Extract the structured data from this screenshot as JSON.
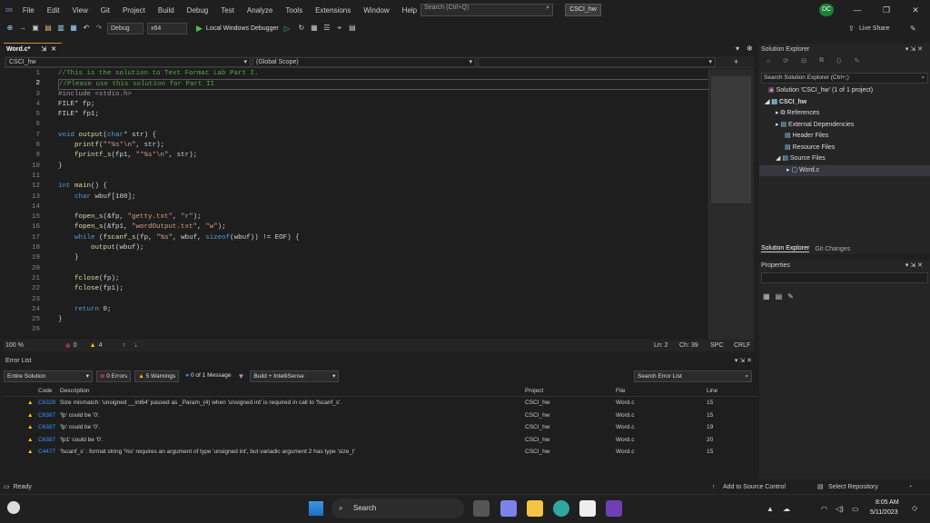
{
  "menu": {
    "items": [
      "File",
      "Edit",
      "View",
      "Git",
      "Project",
      "Build",
      "Debug",
      "Test",
      "Analyze",
      "Tools",
      "Extensions",
      "Window",
      "Help"
    ],
    "search_placeholder": "Search (Ctrl+Q)",
    "solution_badge": "CSCI_hw",
    "avatar_initials": "DC",
    "live_share": "Live Share"
  },
  "toolbar": {
    "config": "Debug",
    "platform": "x64",
    "run_label": "Local Windows Debugger"
  },
  "editor": {
    "tab_label": "Word.c*",
    "nav_project": "CSCI_hw",
    "nav_scope": "(Global Scope)",
    "line_numbers": [
      "1",
      "2",
      "3",
      "4",
      "5",
      "6",
      "7",
      "8",
      "9",
      "10",
      "11",
      "12",
      "13",
      "14",
      "15",
      "16",
      "17",
      "18",
      "19",
      "20",
      "21",
      "22",
      "23",
      "24",
      "25",
      "26"
    ],
    "zoom": "100 %",
    "errors_count": "0",
    "warnings_count": "4",
    "position_line": "Ln: 2",
    "position_col": "Ch: 39",
    "spacing": "SPC",
    "line_ending": "CRLF"
  },
  "solution_explorer": {
    "title": "Solution Explorer",
    "search_placeholder": "Search Solution Explorer (Ctrl+;)",
    "solution_node": "Solution 'CSCI_hw' (1 of 1 project)",
    "project_node": "CSCI_hw",
    "children": [
      "References",
      "External Dependencies",
      "Header Files",
      "Resource Files",
      "Source Files"
    ],
    "file_node": "Word.c",
    "bottom_tabs": [
      "Solution Explorer",
      "Git Changes"
    ]
  },
  "properties": {
    "title": "Properties"
  },
  "error_list": {
    "title": "Error List",
    "scope": "Entire Solution",
    "errors_btn": "0 Errors",
    "warnings_btn": "5 Warnings",
    "messages_btn": "0 of 1 Message",
    "build_filter": "Build + IntelliSense",
    "search_placeholder": "Search Error List",
    "columns": [
      "Code",
      "Description",
      "Project",
      "File",
      "Line"
    ],
    "rows": [
      {
        "code": "C6328",
        "desc": "Size mismatch: 'unsigned __int64' passed as _Param_(4) when 'unsigned int' is required in call to 'fscanf_s'.",
        "project": "CSCI_hw",
        "file": "Word.c",
        "line": "15"
      },
      {
        "code": "C6387",
        "desc": "'fp' could be '0'.",
        "project": "CSCI_hw",
        "file": "Word.c",
        "line": "15"
      },
      {
        "code": "C6387",
        "desc": "'fp' could be '0'.",
        "project": "CSCI_hw",
        "file": "Word.c",
        "line": "19"
      },
      {
        "code": "C6387",
        "desc": "'fp1' could be '0'.",
        "project": "CSCI_hw",
        "file": "Word.c",
        "line": "20"
      },
      {
        "code": "C4477",
        "desc": "'fscanf_s' : format string '%s' requires an argument of type 'unsigned int', but variadic argument 2 has type 'size_t'",
        "project": "CSCI_hw",
        "file": "Word.c",
        "line": "15"
      }
    ]
  },
  "status": {
    "ready": "Ready",
    "add_source": "Add to Source Control",
    "select_repo": "Select Repository"
  },
  "taskbar": {
    "search_label": "Search",
    "time": "8:05 AM",
    "date": "5/11/2023"
  }
}
